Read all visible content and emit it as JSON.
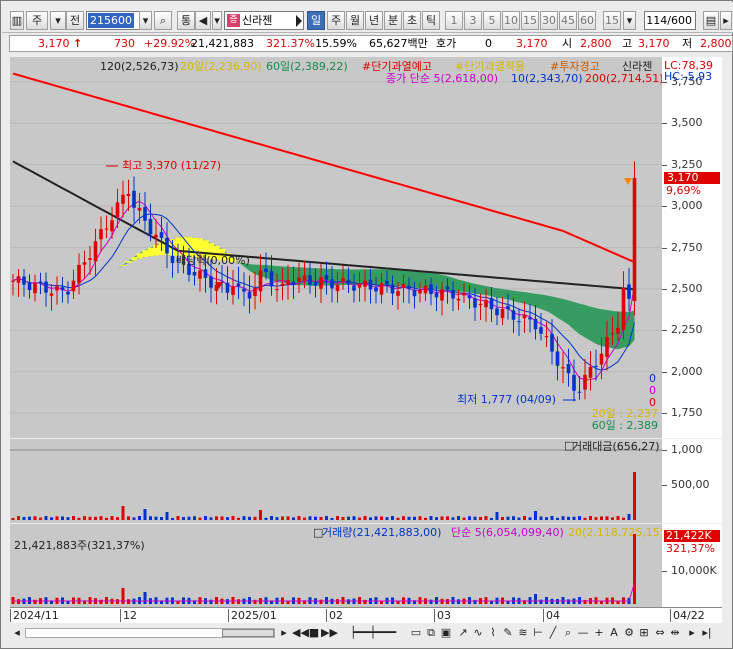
{
  "toolbar": {
    "market_label": "주",
    "prev_label": "전",
    "stock_code": "215600",
    "search_label": "⌕",
    "integrated_label": "통",
    "sound_label": "◀",
    "stock_name_tag": "증",
    "stock_name": "신라젠",
    "periods": [
      "일",
      "주",
      "월",
      "년",
      "분",
      "초",
      "틱"
    ],
    "minutes": [
      "1",
      "3",
      "5",
      "10",
      "15",
      "30",
      "45",
      "60",
      "15"
    ],
    "data_count": "114",
    "data_count_max": "/600"
  },
  "info": {
    "price": "3,170",
    "arrow": "↑",
    "change": "730",
    "change_pct": "+29.92%",
    "volume": "21,421,883",
    "volume_ratio": "321.37%",
    "turnover": "15.59%",
    "trade_value": "65,627백만",
    "quote_label": "호가",
    "quote_value": "0",
    "price2": "3,170",
    "open_label": "시",
    "open": "2,800",
    "high_label": "고",
    "high": "3,170",
    "low_label": "저",
    "low": "2,800"
  },
  "price_pane": {
    "legend_line1": [
      {
        "text": "120(2,526,73)",
        "color": "#222222"
      },
      {
        "text": "20일(2,236,90)",
        "color": "#d4b800"
      },
      {
        "text": "60일(2,389,22)",
        "color": "#1a8a50"
      },
      {
        "text": "#단기과열예고",
        "color": "#e00000"
      },
      {
        "text": "#단기과열적용",
        "color": "#d4b800"
      },
      {
        "text": "#투자경고",
        "color": "#c85a00"
      },
      {
        "text": "신라젠",
        "color": "#222222"
      }
    ],
    "legend_line2": [
      {
        "text": "종가 단순 5(2,618,00)",
        "color": "#cc00cc"
      },
      {
        "text": "10(2,343,70)",
        "color": "#0033cc"
      },
      {
        "text": "200(2,714,51)",
        "color": "#e00000"
      }
    ],
    "lc_label": "LC:78,39",
    "hc_label": "HC:-5,93",
    "high_annotation": "최고 3,370 (11/27)",
    "low_annotation": "최저 1,777 (04/09)",
    "dividend_annotation": "배당락(0,00%)",
    "ma20_bottom": "20일 : 2,237",
    "ma60_bottom": "60일 : 2,389",
    "zero_labels": [
      "0",
      "0",
      "0"
    ],
    "price_tag": "3,170",
    "pct_tag": "9,69%",
    "y_axis": [
      "3,750",
      "3,500",
      "3,250",
      "3,000",
      "2,750",
      "2,500",
      "2,250",
      "2,000",
      "1,750"
    ]
  },
  "value_pane": {
    "title": "거래대금(656,27)",
    "y_axis": [
      "1,000",
      "500,00"
    ]
  },
  "volume_pane": {
    "legend": [
      {
        "text": "거래량(21,421,883,00)",
        "color": "#0033cc"
      },
      {
        "text": "단순 5(6,054,099,40)",
        "color": "#cc00cc"
      },
      {
        "text": "20(2,118,725,15)",
        "color": "#d4b800"
      }
    ],
    "left_label": "21,421,883주(321,37%)",
    "vol_tag": "21,422K",
    "pct_tag": "321,37%",
    "y_axis": [
      "10,000K"
    ]
  },
  "x_axis": [
    "2024/11",
    "12",
    "2025/01",
    "02",
    "03",
    "04",
    "04/22"
  ],
  "colors": {
    "pane_bg": "#c8c8c8",
    "up": "#e00000",
    "down": "#0033cc",
    "ma200": "#ff0000",
    "ma120": "#222222",
    "ma20_fill": "#ffff33",
    "ma60_fill": "#2e9a5c"
  }
}
